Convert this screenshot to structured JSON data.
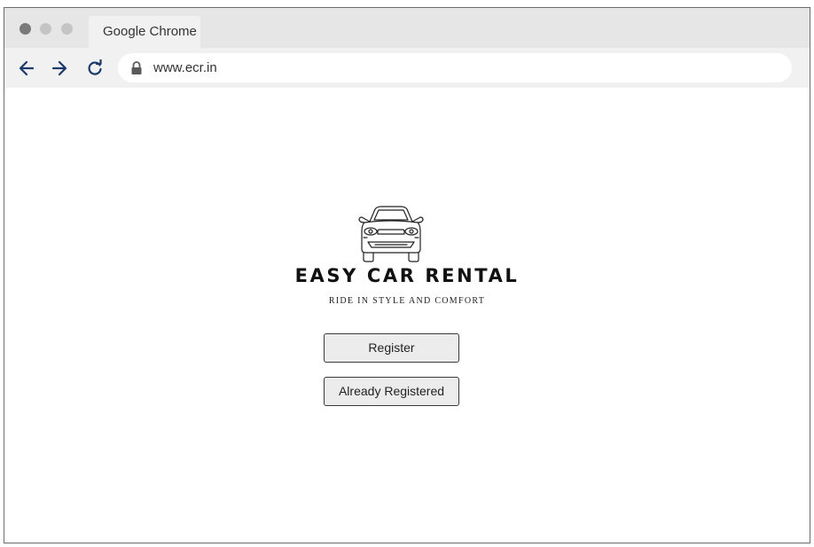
{
  "browser": {
    "tab_title": "Google Chrome",
    "url": "www.ecr.in",
    "window_controls": [
      "close-dot",
      "minimize-dot",
      "maximize-dot"
    ],
    "nav_icons": [
      "back-arrow-icon",
      "forward-arrow-icon",
      "reload-icon",
      "lock-icon"
    ]
  },
  "page": {
    "logo_icon": "car-front-icon",
    "brand_name": "EASY CAR RENTAL",
    "tagline": "RIDE IN STYLE AND COMFORT",
    "buttons": {
      "register": "Register",
      "already_registered": "Already Registered"
    }
  },
  "colors": {
    "titlebar": "#e6e6e6",
    "toolbar": "#f1f1f1",
    "nav_icon": "#1a3a6b",
    "button_bg": "#ececec",
    "button_border": "#3a3a3a"
  }
}
